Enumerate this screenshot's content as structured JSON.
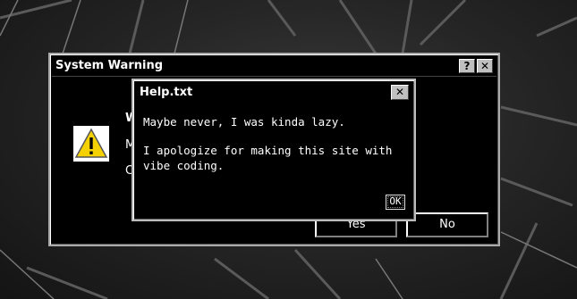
{
  "background": {
    "description_color": "#262626"
  },
  "system_warning": {
    "title": "System Warning",
    "help_button": "?",
    "close_button": "✕",
    "heading_visible": "W",
    "line1_visible": "M",
    "line2_visible": "C",
    "icon": "warning-triangle-icon",
    "yes_button": "Yes",
    "no_button": "No"
  },
  "help_window": {
    "title": "Help.txt",
    "close_button": "✕",
    "paragraph1": "Maybe never, I was kinda lazy.",
    "paragraph2": "I apologize for making this site with vibe coding.",
    "ok_button": "OK"
  }
}
